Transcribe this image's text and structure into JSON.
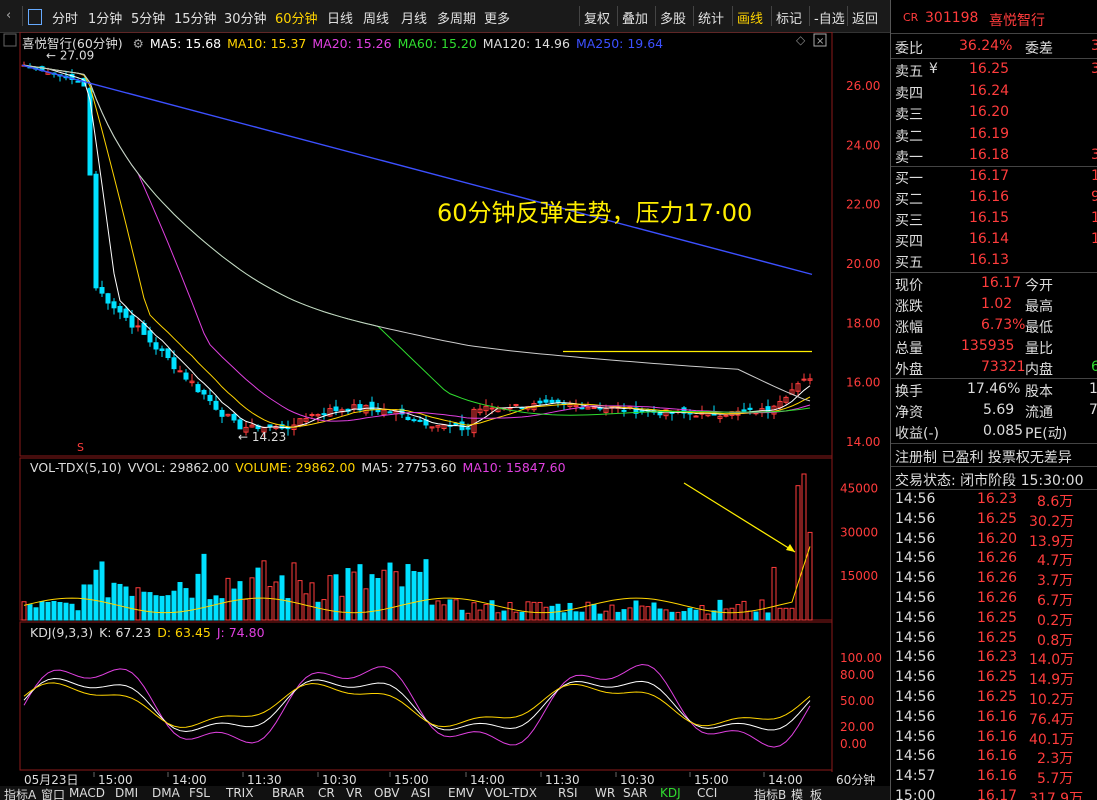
{
  "toolbar": {
    "periods": [
      "分时",
      "1分钟",
      "5分钟",
      "15分钟",
      "30分钟",
      "60分钟",
      "日线",
      "周线",
      "月线",
      "多周期",
      "更多"
    ],
    "active_period": "60分钟",
    "right_items": [
      "复权",
      "叠加",
      "多股",
      "统计",
      "画线",
      "标记",
      "-自选",
      "返回"
    ],
    "active_right": "画线"
  },
  "chart_title": "喜悦智行(60分钟)",
  "ma_legend": [
    {
      "label": "MA5: 15.68",
      "color": "#ffffff"
    },
    {
      "label": "MA10: 15.37",
      "color": "#ffd400"
    },
    {
      "label": "MA20: 15.26",
      "color": "#e040e0"
    },
    {
      "label": "MA60: 15.20",
      "color": "#2fdc2f"
    },
    {
      "label": "MA120: 14.96",
      "color": "#dddddd"
    },
    {
      "label": "MA250: 19.64",
      "color": "#3c50ff"
    }
  ],
  "annotation": "60分钟反弹走势，压力17·00",
  "price_labels": {
    "high": "27.09",
    "low": "14.23"
  },
  "price_axis": [
    "26.00",
    "24.00",
    "22.00",
    "20.00",
    "18.00",
    "16.00",
    "14.00"
  ],
  "vol_legend": [
    {
      "label": "VOL-TDX(5,10)",
      "color": "#dddddd"
    },
    {
      "label": "VVOL: 29862.00",
      "color": "#dddddd"
    },
    {
      "label": "VOLUME: 29862.00",
      "color": "#ffd400"
    },
    {
      "label": "MA5: 27753.60",
      "color": "#dddddd"
    },
    {
      "label": "MA10: 15847.60",
      "color": "#e040e0"
    }
  ],
  "vol_axis": [
    "45000",
    "30000",
    "15000"
  ],
  "kdj_legend": [
    {
      "label": "KDJ(9,3,3)",
      "color": "#dddddd"
    },
    {
      "label": "K: 67.23",
      "color": "#dddddd"
    },
    {
      "label": "D: 63.45",
      "color": "#ffd400"
    },
    {
      "label": "J: 74.80",
      "color": "#e040e0"
    }
  ],
  "kdj_axis": [
    "100.00",
    "80.00",
    "50.00",
    "20.00",
    "0.00"
  ],
  "time_axis": [
    "05月23日",
    "15:00",
    "14:00",
    "11:30",
    "10:30",
    "15:00",
    "14:00",
    "11:30",
    "10:30",
    "15:00",
    "14:00"
  ],
  "time_period": "60分钟",
  "bottom_tabs": [
    "指标A",
    "窗口",
    "MACD",
    "DMI",
    "DMA",
    "FSL",
    "TRIX",
    "BRAR",
    "CR",
    "VR",
    "OBV",
    "ASI",
    "EMV",
    "VOL-TDX",
    "RSI",
    "WR",
    "SAR",
    "KDJ",
    "CCI",
    "指标B",
    "模",
    "板"
  ],
  "stock": {
    "code": "301198",
    "name": "喜悦智行",
    "badge": "CR"
  },
  "ratio": {
    "wb_label": "委比",
    "wb_value": "36.24%",
    "wc_label": "委差",
    "wc_value": "3"
  },
  "asks": [
    {
      "label": "卖五",
      "mark": "¥",
      "price": "16.25",
      "vol": "3"
    },
    {
      "label": "卖四",
      "mark": "",
      "price": "16.24",
      "vol": ""
    },
    {
      "label": "卖三",
      "mark": "",
      "price": "16.20",
      "vol": ""
    },
    {
      "label": "卖二",
      "mark": "",
      "price": "16.19",
      "vol": ""
    },
    {
      "label": "卖一",
      "mark": "",
      "price": "16.18",
      "vol": "3"
    }
  ],
  "bids": [
    {
      "label": "买一",
      "price": "16.17",
      "vol": "1"
    },
    {
      "label": "买二",
      "price": "16.16",
      "vol": "9"
    },
    {
      "label": "买三",
      "price": "16.15",
      "vol": "1"
    },
    {
      "label": "买四",
      "price": "16.14",
      "vol": "1"
    },
    {
      "label": "买五",
      "price": "16.13",
      "vol": ""
    }
  ],
  "quote": [
    {
      "l1": "现价",
      "v1": "16.17",
      "c1": "red",
      "l2": "今开",
      "v2": ""
    },
    {
      "l1": "涨跌",
      "v1": "1.02",
      "c1": "red",
      "l2": "最高",
      "v2": ""
    },
    {
      "l1": "涨幅",
      "v1": "6.73%",
      "c1": "red",
      "l2": "最低",
      "v2": ""
    },
    {
      "l1": "总量",
      "v1": "135935",
      "c1": "red",
      "l2": "量比",
      "v2": ""
    },
    {
      "l1": "外盘",
      "v1": "73321",
      "c1": "red",
      "l2": "内盘",
      "v2": "6"
    }
  ],
  "quote2": [
    {
      "l1": "换手",
      "v1": "17.46%",
      "l2": "股本",
      "v2": "1"
    },
    {
      "l1": "净资",
      "v1": "5.69",
      "l2": "流通",
      "v2": "7"
    },
    {
      "l1": "收益(-)",
      "v1": "0.085",
      "l2": "PE(动)",
      "v2": ""
    }
  ],
  "info_line": "注册制 已盈利 投票权无差异",
  "status_line": "交易状态: 闭市阶段 15:30:00",
  "ticks": [
    {
      "t": "14:56",
      "p": "16.23",
      "v": "8.6万"
    },
    {
      "t": "14:56",
      "p": "16.25",
      "v": "30.2万"
    },
    {
      "t": "14:56",
      "p": "16.20",
      "v": "13.9万"
    },
    {
      "t": "14:56",
      "p": "16.26",
      "v": "4.7万"
    },
    {
      "t": "14:56",
      "p": "16.26",
      "v": "3.7万"
    },
    {
      "t": "14:56",
      "p": "16.26",
      "v": "6.7万"
    },
    {
      "t": "14:56",
      "p": "16.25",
      "v": "0.2万"
    },
    {
      "t": "14:56",
      "p": "16.25",
      "v": "0.8万"
    },
    {
      "t": "14:56",
      "p": "16.23",
      "v": "14.0万"
    },
    {
      "t": "14:56",
      "p": "16.25",
      "v": "14.9万"
    },
    {
      "t": "14:56",
      "p": "16.25",
      "v": "10.2万"
    },
    {
      "t": "14:56",
      "p": "16.16",
      "v": "76.4万"
    },
    {
      "t": "14:56",
      "p": "16.16",
      "v": "40.1万"
    },
    {
      "t": "14:56",
      "p": "16.16",
      "v": "2.3万"
    },
    {
      "t": "14:57",
      "p": "16.16",
      "v": "5.7万"
    },
    {
      "t": "15:00",
      "p": "16.17",
      "v": "317.9万"
    }
  ],
  "colors": {
    "up": "#ff3c3c",
    "down": "#00e0ff",
    "ma250": "#3c50ff",
    "annotation": "#ffee00"
  }
}
